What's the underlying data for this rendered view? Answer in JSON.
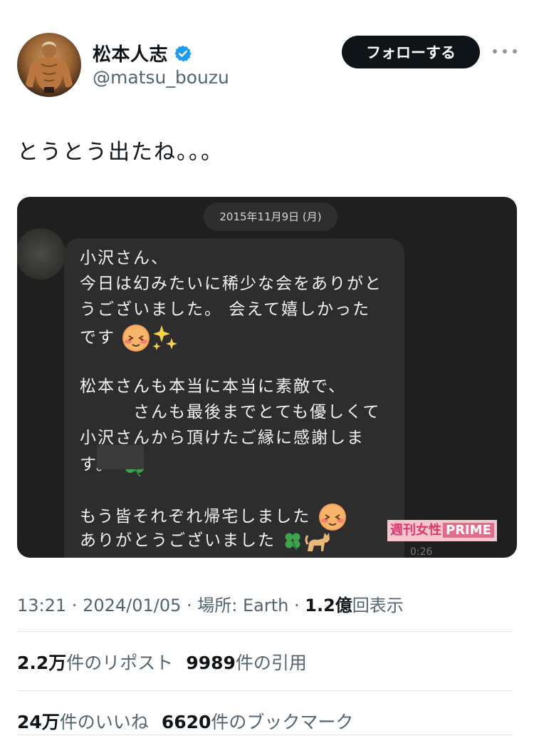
{
  "author": {
    "display_name": "松本人志",
    "handle": "@matsu_bouzu",
    "follow_label": "フォローする",
    "verified": true
  },
  "tweet": {
    "text": "とうとう出たね。。。"
  },
  "media": {
    "date_label": "2015年11月9日 (月)",
    "message_lines": [
      "小沢さん、",
      "今日は幻みたいに稀少な会をありがと",
      "うございました。 会えて嬉しかった",
      "です",
      "",
      "松本さんも本当に本当に素敵で、",
      "　　　さんも最後までとても優しくて",
      "小沢さんから頂けたご縁に感謝しま",
      "す。",
      "",
      "もう皆それぞれ帰宅しました",
      "ありがとうございました"
    ],
    "watermark": "週刊女性",
    "watermark_brand": "PRIME",
    "duration": "0:26"
  },
  "meta": {
    "time": "13:21",
    "separator": " · ",
    "date": "2024/01/05",
    "location_label": "場所: Earth",
    "views_value": "1.2億",
    "views_label": "回表示"
  },
  "stats": {
    "reposts_value": "2.2万",
    "reposts_label": "件のリポスト",
    "quotes_value": "9989",
    "quotes_label": "件の引用",
    "likes_value": "24万",
    "likes_label": "件のいいね",
    "bookmarks_value": "6620",
    "bookmarks_label": "件のブックマーク"
  },
  "colors": {
    "text_primary": "#0f1419",
    "text_secondary": "#536471",
    "verified_blue": "#1d9bf0",
    "media_background": "#1f1f1f",
    "watermark_pink": "#e46b8b"
  },
  "icons": [
    "verified-badge-icon",
    "more-options-icon"
  ]
}
